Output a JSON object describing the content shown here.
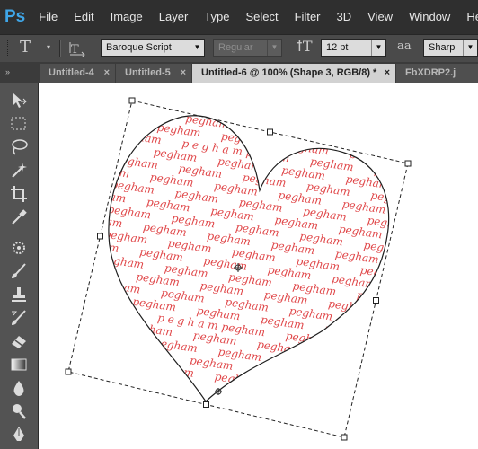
{
  "app": {
    "logo": "Ps"
  },
  "menu": [
    "File",
    "Edit",
    "Image",
    "Layer",
    "Type",
    "Select",
    "Filter",
    "3D",
    "View",
    "Window",
    "Help"
  ],
  "options": {
    "type_tool_icon": "type-tool-icon",
    "orientation_icon": "text-orientation-icon",
    "font_family": "Baroque Script",
    "font_style": "Regular",
    "font_size_icon": "font-size-icon",
    "font_size": "12 pt",
    "antialias_icon": "antialias-icon",
    "antialias_label": "a a",
    "antialias": "Sharp"
  },
  "tabs": [
    {
      "label": "Untitled-4",
      "close": "×",
      "active": false
    },
    {
      "label": "Untitled-5",
      "close": "×",
      "active": false
    },
    {
      "label": "Untitled-6 @ 100% (Shape 3, RGB/8) *",
      "close": "×",
      "active": true
    },
    {
      "label": "FbXDRP2.j",
      "close": "",
      "active": false
    }
  ],
  "toolbar_grip": "»",
  "tools": [
    "move-tool-icon",
    "marquee-tool-icon",
    "lasso-tool-icon",
    "quick-selection-tool-icon",
    "crop-tool-icon",
    "eyedropper-tool-icon",
    "spot-healing-tool-icon",
    "brush-tool-icon",
    "clone-stamp-tool-icon",
    "history-brush-tool-icon",
    "eraser-tool-icon",
    "gradient-tool-icon",
    "blur-tool-icon",
    "dodge-tool-icon",
    "pen-tool-icon"
  ],
  "canvas_text": {
    "word": "pegham",
    "spaced_word": "p e g h a m",
    "color": "#e0484a"
  },
  "colors": {
    "menubar": "#2f2f2f",
    "panel": "#535353",
    "accent": "#3fa6e8"
  }
}
